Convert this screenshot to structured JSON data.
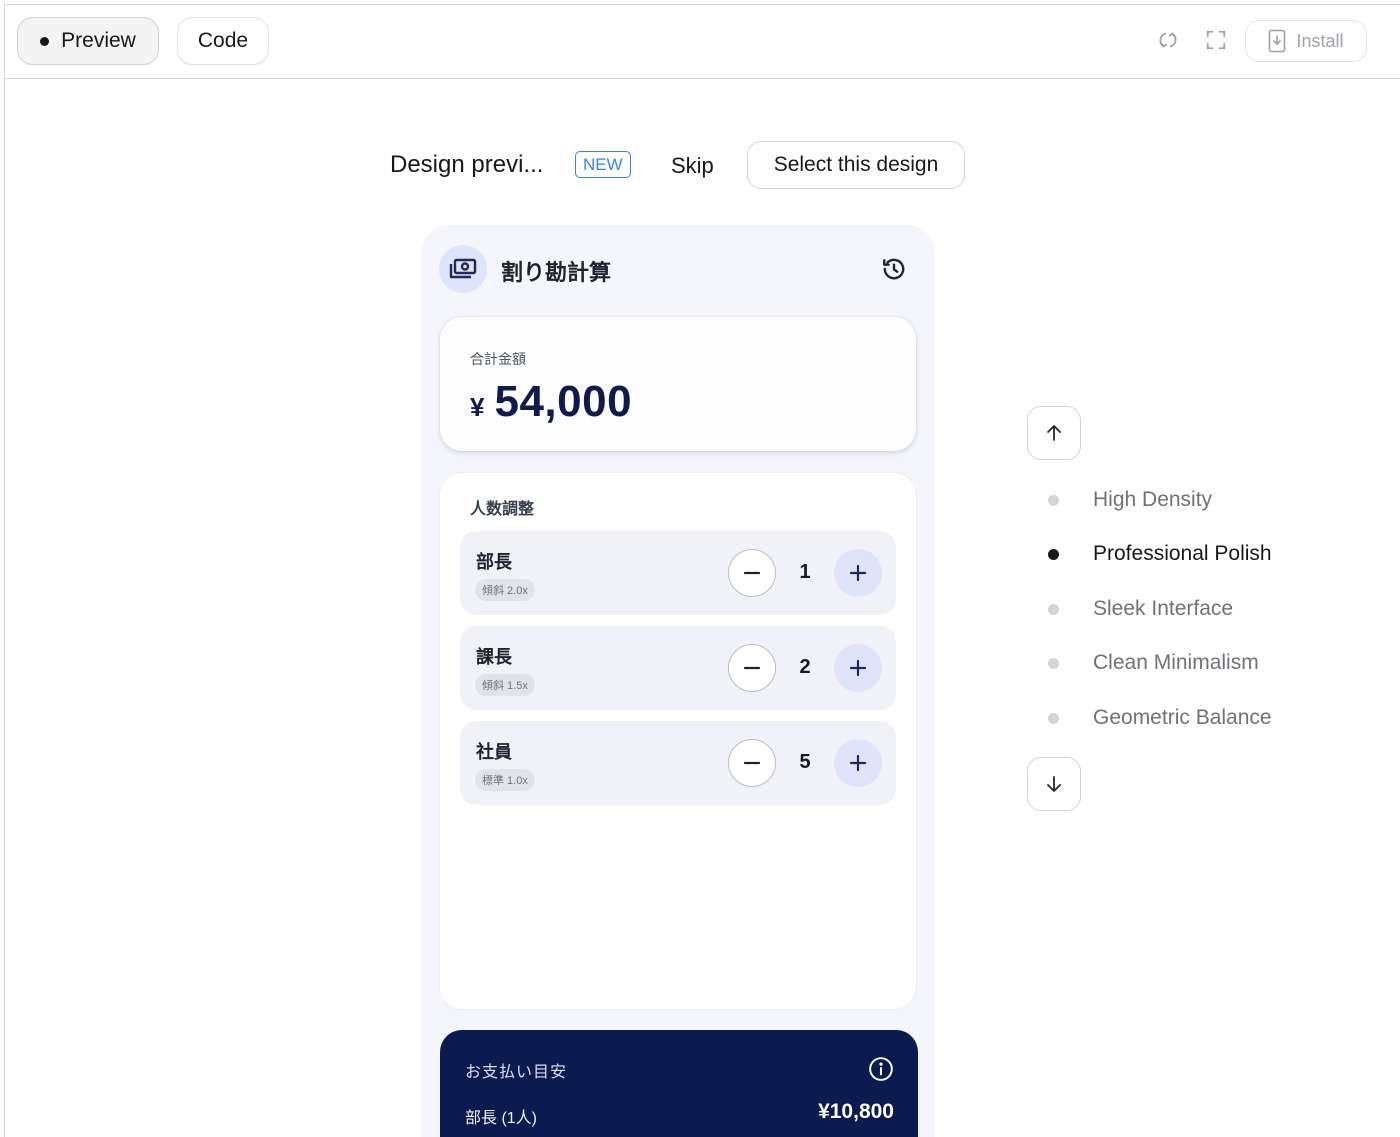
{
  "toolbar": {
    "preview_label": "Preview",
    "code_label": "Code",
    "install_label": "Install"
  },
  "design_bar": {
    "title": "Design previ...",
    "new_badge": "NEW",
    "skip_label": "Skip",
    "select_label": "Select this design"
  },
  "app": {
    "title": "割り勘計算",
    "total": {
      "label": "合計金額",
      "currency": "¥",
      "amount": "54,000"
    },
    "people": {
      "title": "人数調整",
      "rows": [
        {
          "name": "部長",
          "badge": "傾斜 2.0x",
          "count": "1"
        },
        {
          "name": "課長",
          "badge": "傾斜 1.5x",
          "count": "2"
        },
        {
          "name": "社員",
          "badge": "標準 1.0x",
          "count": "5"
        }
      ]
    },
    "payment": {
      "title": "お支払い目安",
      "rows": [
        {
          "label": "部長 (1人)",
          "value": "¥10,800"
        }
      ]
    }
  },
  "designs": {
    "options": [
      {
        "label": "High Density",
        "active": false
      },
      {
        "label": "Professional Polish",
        "active": true
      },
      {
        "label": "Sleek Interface",
        "active": false
      },
      {
        "label": "Clean Minimalism",
        "active": false
      },
      {
        "label": "Geometric Balance",
        "active": false
      }
    ]
  },
  "colors": {
    "navy": "#0b1a4f",
    "accent_light": "#dfe4fb",
    "new_badge": "#3b82f6"
  }
}
